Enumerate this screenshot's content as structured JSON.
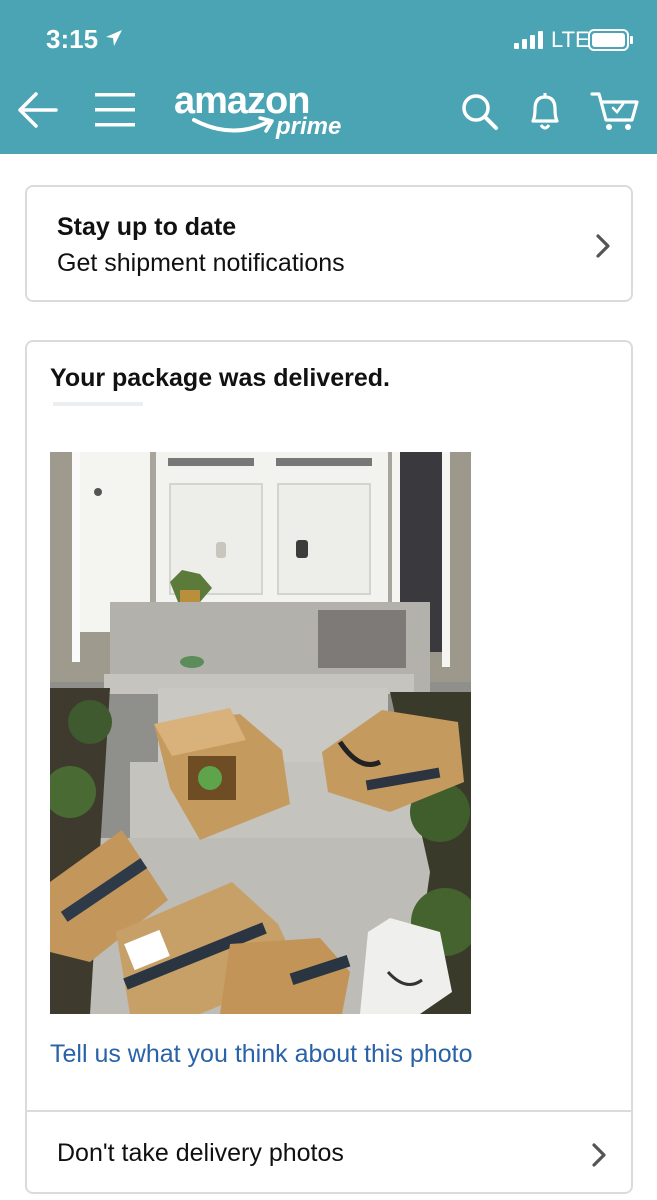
{
  "status_bar": {
    "time": "3:15",
    "carrier": "LTE"
  },
  "nav": {
    "logo_text": "amazon",
    "logo_sub": "prime",
    "icons": [
      "back-arrow-icon",
      "menu-icon",
      "search-icon",
      "bell-icon",
      "cart-icon"
    ]
  },
  "notify_card": {
    "title": "Stay up to date",
    "subtitle": "Get shipment notifications"
  },
  "delivery_card": {
    "title": "Your package was delivered.",
    "feedback_link": "Tell us what you think about this photo",
    "photo_option": "Don't take delivery photos"
  },
  "colors": {
    "header": "#4ba4b3",
    "link": "#2a62a8",
    "border": "#d9dcdf"
  }
}
